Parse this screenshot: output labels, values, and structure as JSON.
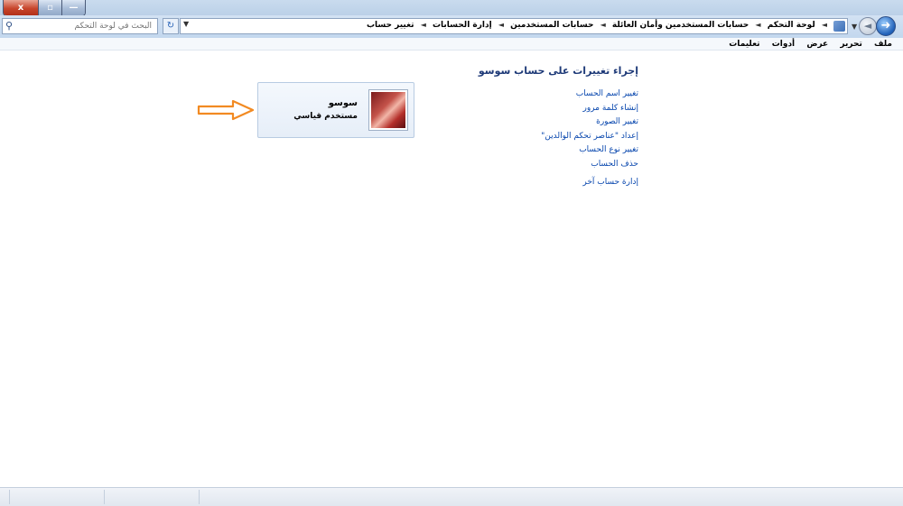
{
  "window": {
    "caption_buttons": {
      "close": "x",
      "maximize": "▫",
      "minimize": "—"
    }
  },
  "nav": {
    "search_placeholder": "البحث في لوحة التحكم",
    "breadcrumbs": [
      "لوحة التحكم",
      "حسابات المستخدمين وأمان العائلة",
      "حسابات المستخدمين",
      "إدارة الحسابات",
      "تغيير حساب"
    ]
  },
  "menu": [
    "ملف",
    "تحرير",
    "عرض",
    "أدوات",
    "تعليمات"
  ],
  "content": {
    "title": "إجراء تغييرات على حساب سوسو",
    "tasks": [
      "تغيير اسم الحساب",
      "إنشاء كلمة مرور",
      "تغيير الصورة",
      "إعداد \"عناصر تحكم الوالدين\"",
      "تغيير نوع الحساب",
      "حذف الحساب"
    ],
    "manage_other": "إدارة حساب آخر"
  },
  "account": {
    "name": "سوسو",
    "type": "مستخدم قياسي"
  },
  "colors": {
    "link": "#0645ad",
    "title": "#1e3a78",
    "arrow": "#f28a22"
  },
  "icons": [
    "close-icon",
    "maximize-icon",
    "minimize-icon",
    "search-icon",
    "refresh-icon",
    "back-icon",
    "forward-icon",
    "arrow-pointer-icon"
  ]
}
